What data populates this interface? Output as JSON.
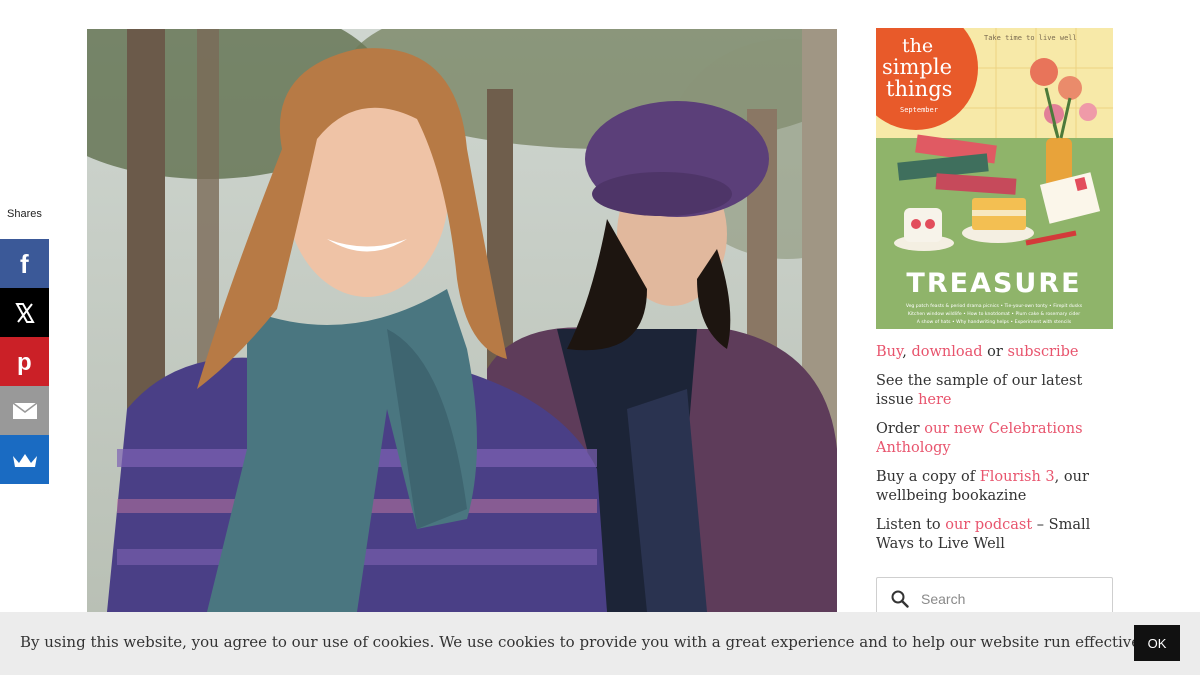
{
  "share": {
    "label": "Shares",
    "buttons": [
      {
        "name": "facebook",
        "icon": "facebook-icon",
        "color": "#3b5998"
      },
      {
        "name": "x",
        "icon": "x-icon",
        "color": "#000000"
      },
      {
        "name": "pinterest",
        "icon": "pinterest-icon",
        "color": "#cb2027"
      },
      {
        "name": "email",
        "icon": "email-icon",
        "color": "#999999"
      },
      {
        "name": "sumo",
        "icon": "crown-icon",
        "color": "#1a6bc2"
      }
    ]
  },
  "cover": {
    "brand_line1": "the",
    "brand_line2": "simple",
    "brand_line3": "things",
    "month": "September",
    "tagline": "Take time to live well",
    "headline": "TREASURE",
    "coverlines": [
      "Veg patch feasts & period drama picnics • Tie-your-own tonty • Firepit dusks",
      "Kitchen window wildlife • How to knotdomat • Plum cake & rosemary cider",
      "A show of hats • Why handwriting helps • Experiment with stencils"
    ]
  },
  "sidebar": {
    "buy": "Buy",
    "sep1": ", ",
    "download": "download",
    "or": " or ",
    "subscribe": "subscribe",
    "sample_text": "See the sample of our latest issue ",
    "sample_link": "here",
    "order_text": "Order ",
    "order_link": "our new Celebrations Anthology",
    "buy_copy_text": "Buy a copy of ",
    "flourish_link": "Flourish 3",
    "flourish_after": ", our wellbeing bookazine",
    "listen_text": "Listen to ",
    "podcast_link": "our podcast",
    "podcast_after": " – Small Ways to Live Well"
  },
  "search": {
    "placeholder": "Search"
  },
  "cookie": {
    "text": "By using this website, you agree to our use of cookies. We use cookies to provide you with a great experience and to help our website run effectively.",
    "ok": "OK"
  },
  "colors": {
    "link": "#e8546d",
    "cookie_bg": "#ececec",
    "ok_bg": "#111111"
  }
}
